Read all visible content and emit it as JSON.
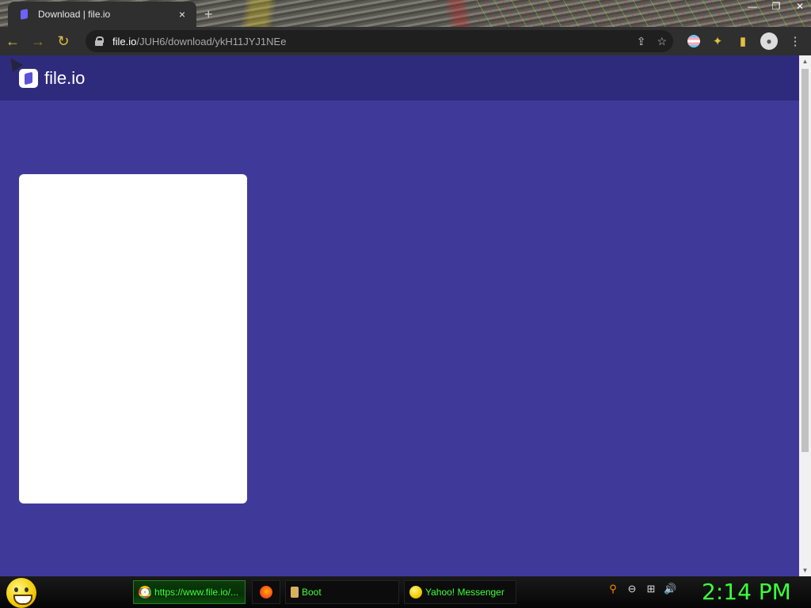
{
  "browser": {
    "tab": {
      "title": "Download | file.io",
      "close_icon": "×"
    },
    "new_tab_icon": "+",
    "window_controls": {
      "minimize": "—",
      "restore": "❐",
      "close": "✕"
    },
    "nav": {
      "back": "←",
      "forward": "→",
      "reload": "↻"
    },
    "address_bar": {
      "host": "file.io",
      "path": "/JUH6/download/ykH11JYJ1NEe"
    },
    "omnibox_icons": {
      "share": "⇪",
      "bookmark": "☆"
    },
    "extensions": {
      "puzzle": "✦",
      "sidebar": "▮",
      "avatar": "●",
      "menu": "⋮"
    }
  },
  "page": {
    "logo_text": "file.io",
    "brand_colors": {
      "background": "#3f3a9a",
      "header": "#2f2b7c",
      "card": "#ffffff"
    }
  },
  "taskbar": {
    "items": [
      {
        "label": "https://www.file.io/...",
        "icon": "chrome-icon",
        "active": true
      },
      {
        "label": "",
        "icon": "firefox-icon",
        "active": false
      },
      {
        "label": "Boot",
        "icon": "boot-icon",
        "active": false
      },
      {
        "label": "Yahoo! Messenger",
        "icon": "yahoo-messenger-icon",
        "active": false
      }
    ],
    "tray_icons": {
      "search": "⚲",
      "minus": "⊖",
      "network": "⊞",
      "volume": "🔊"
    },
    "clock": "2:14 PM"
  }
}
